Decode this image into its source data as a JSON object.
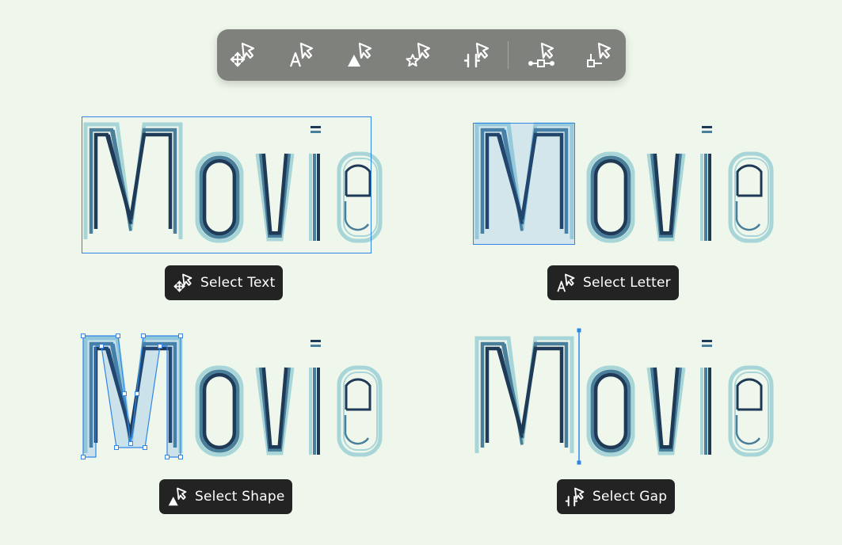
{
  "toolbar": {
    "tools": [
      {
        "name": "select-text-tool",
        "icon": "move-arrows-cursor-icon"
      },
      {
        "name": "select-letter-tool",
        "icon": "letter-a-cursor-icon"
      },
      {
        "name": "select-shape-tool",
        "icon": "triangle-cursor-icon"
      },
      {
        "name": "select-star-tool",
        "icon": "star-cursor-icon"
      },
      {
        "name": "select-gap-tool",
        "icon": "gap-bars-cursor-icon"
      },
      {
        "name": "select-point-tool",
        "icon": "node-path-cursor-icon"
      },
      {
        "name": "select-node-tool",
        "icon": "square-node-cursor-icon"
      }
    ]
  },
  "demos": {
    "text": {
      "label": "Select Text",
      "icon": "move-arrows-cursor-icon"
    },
    "letter": {
      "label": "Select Letter",
      "icon": "letter-a-cursor-icon"
    },
    "shape": {
      "label": "Select Shape",
      "icon": "triangle-cursor-icon"
    },
    "gap": {
      "label": "Select Gap",
      "icon": "gap-bars-cursor-icon"
    }
  },
  "colors": {
    "background": "#eff7ec",
    "toolbar": "#7f817c",
    "pill": "#232323",
    "selection": "#2f86e8",
    "stroke_outer": "#a8d6d8",
    "stroke_mid": "#4a7f9c",
    "stroke_inner": "#1f3a57"
  }
}
